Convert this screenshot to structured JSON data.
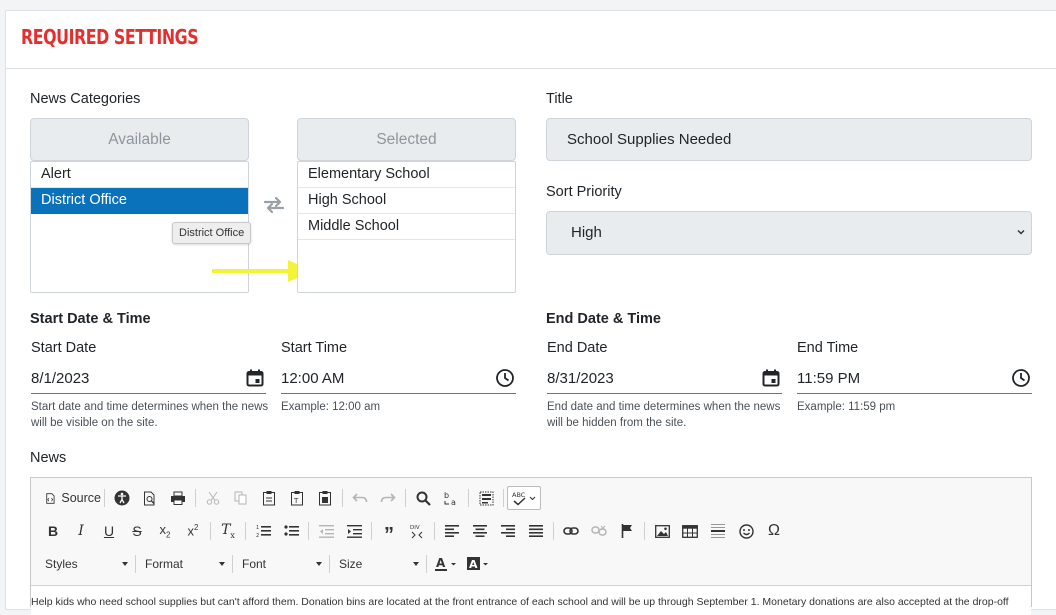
{
  "section": {
    "title": "REQUIRED SETTINGS"
  },
  "categories": {
    "label": "News Categories",
    "available_header": "Available",
    "selected_header": "Selected",
    "available_items": [
      "Alert",
      "District Office"
    ],
    "available_selected_index": 1,
    "selected_items": [
      "Elementary School",
      "High School",
      "Middle School"
    ],
    "tooltip": "District Office"
  },
  "title_field": {
    "label": "Title",
    "value": "School Supplies Needed"
  },
  "sort_priority": {
    "label": "Sort Priority",
    "value": "High"
  },
  "start": {
    "heading": "Start Date & Time",
    "date_label": "Start Date",
    "date_value": "8/1/2023",
    "time_label": "Start Time",
    "time_value": "12:00 AM",
    "help": "Start date and time determines when the news will be visible on the site.",
    "time_example": "Example: 12:00 am"
  },
  "end": {
    "heading": "End Date & Time",
    "date_label": "End Date",
    "date_value": "8/31/2023",
    "time_label": "End Time",
    "time_value": "11:59 PM",
    "help": "End date and time determines when the news will be hidden from the site.",
    "time_example": "Example: 11:59 pm"
  },
  "news": {
    "label": "News",
    "toolbar": {
      "source_label": "Source",
      "styles_label": "Styles",
      "format_label": "Format",
      "font_label": "Font",
      "size_label": "Size"
    },
    "body_text": "Help kids who need school supplies but can't afford them. Donation bins are located at the front entrance of each school and will be up through September 1. Monetary donations are also accepted at the drop-off"
  },
  "colors": {
    "title_red": "#e62e2e",
    "selection_blue": "#0a72bb",
    "arrow_yellow": "#f5f23a"
  }
}
